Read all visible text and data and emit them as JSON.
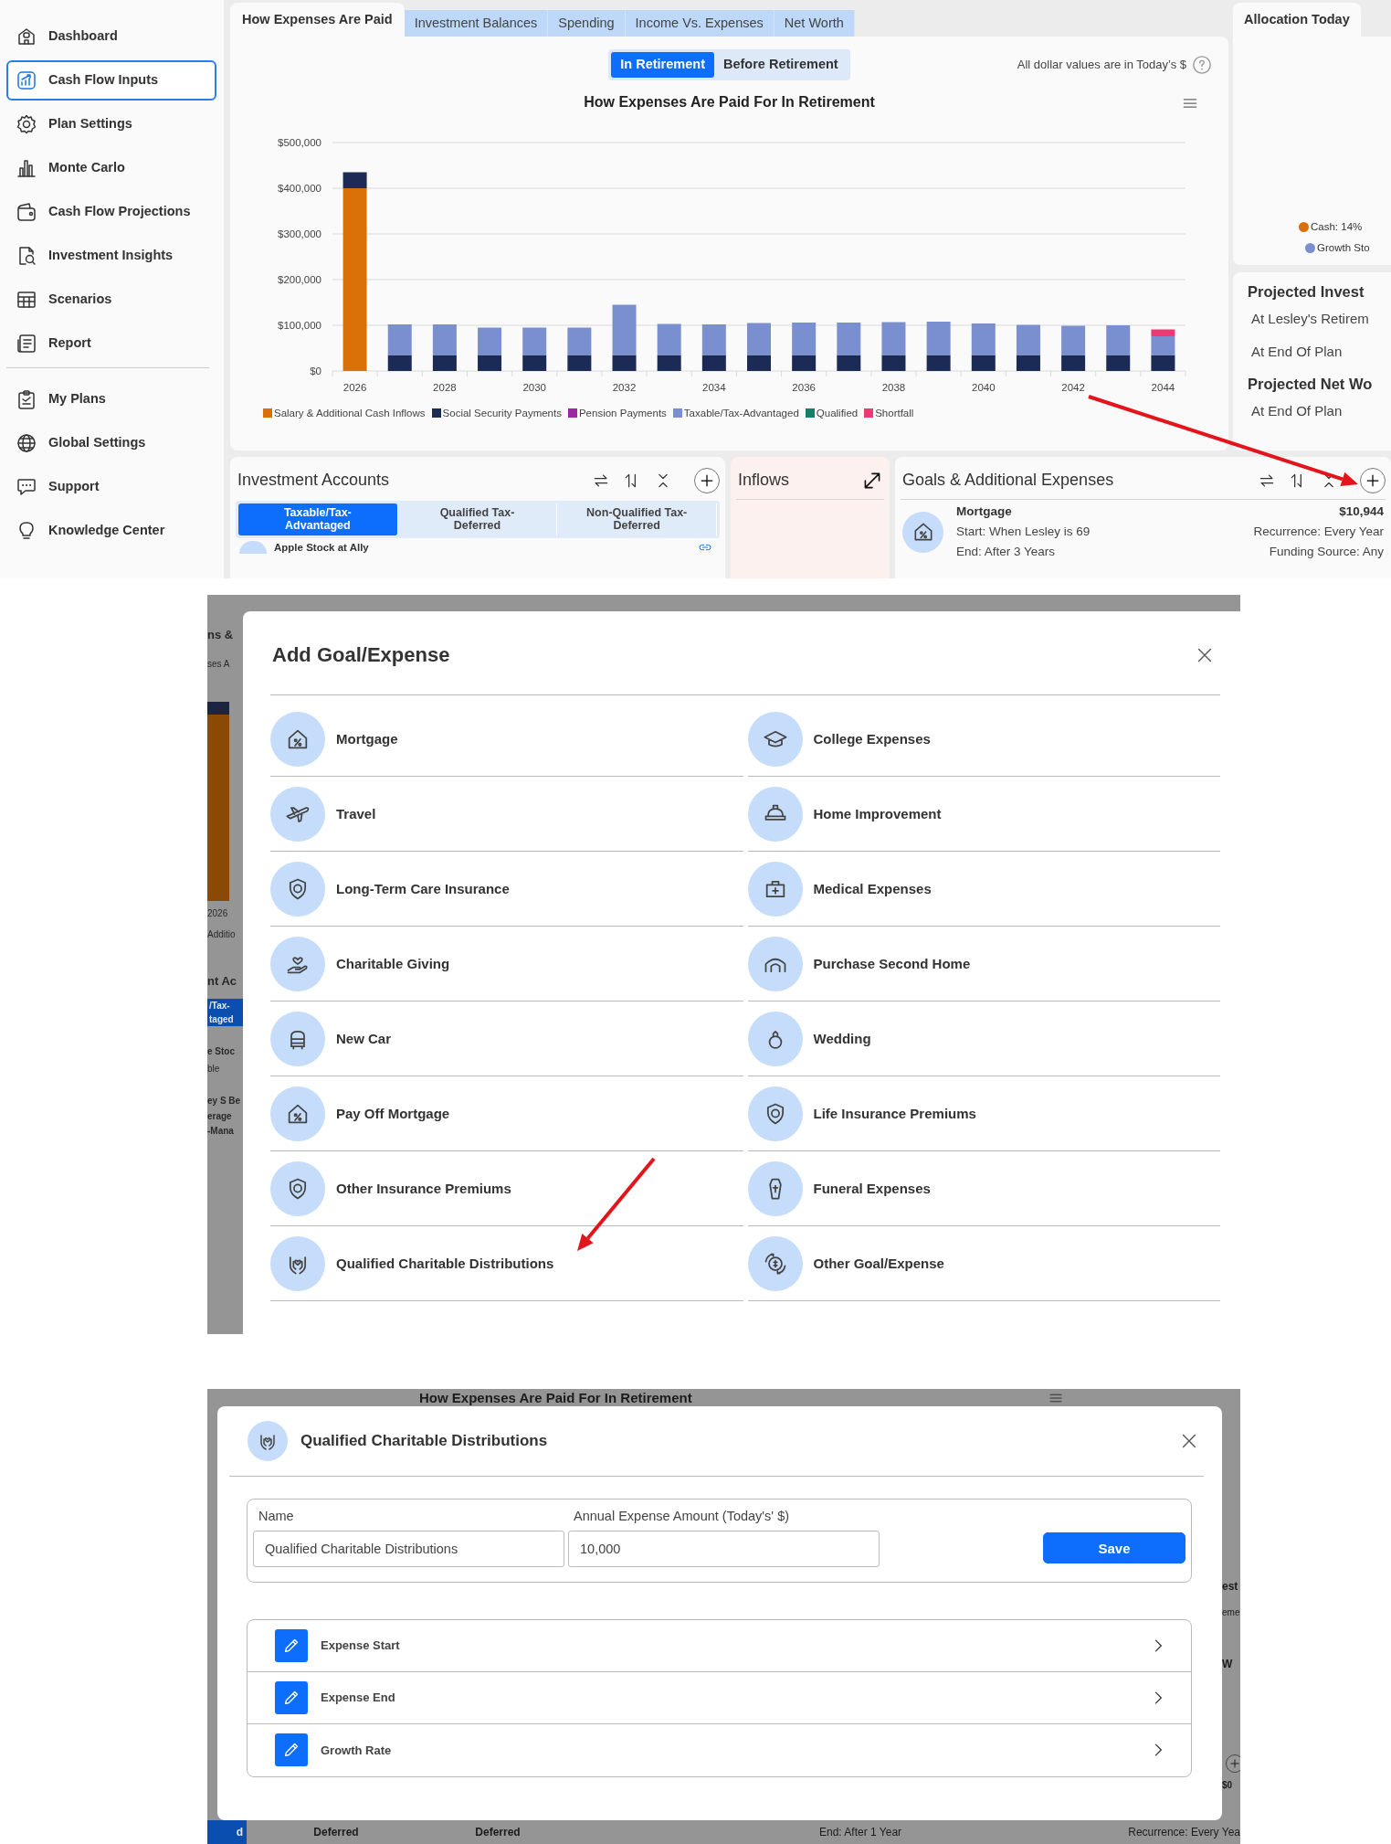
{
  "sidebar": {
    "items": [
      {
        "label": "Dashboard",
        "selected": false
      },
      {
        "label": "Cash Flow Inputs",
        "selected": true
      },
      {
        "label": "Plan Settings",
        "selected": false
      },
      {
        "label": "Monte Carlo",
        "selected": false
      },
      {
        "label": "Cash Flow Projections",
        "selected": false
      },
      {
        "label": "Investment Insights",
        "selected": false
      },
      {
        "label": "Scenarios",
        "selected": false
      },
      {
        "label": "Report",
        "selected": false
      }
    ],
    "secondary_items": [
      {
        "label": "My Plans",
        "selected": false
      },
      {
        "label": "Global Settings",
        "selected": false
      },
      {
        "label": "Support",
        "selected": false
      },
      {
        "label": "Knowledge Center",
        "selected": false
      }
    ]
  },
  "tabs": [
    {
      "label": "How Expenses Are Paid",
      "selected": true
    },
    {
      "label": "Investment Balances",
      "selected": false
    },
    {
      "label": "Spending",
      "selected": false
    },
    {
      "label": "Income Vs. Expenses",
      "selected": false
    },
    {
      "label": "Net Worth",
      "selected": false
    }
  ],
  "side_tab": {
    "label": "Allocation Today",
    "selected": true
  },
  "chart_panel": {
    "toggle": [
      {
        "label": "In Retirement",
        "selected": true
      },
      {
        "label": "Before Retirement",
        "selected": false
      }
    ],
    "note": "All dollar values are in Today’s $",
    "chart_data": {
      "type": "bar",
      "title": "How Expenses Are Paid For In Retirement",
      "stacked": true,
      "grid": true,
      "legend": true,
      "xlim": [
        2025.5,
        2044.5
      ],
      "x": [
        2026,
        2027,
        2028,
        2029,
        2030,
        2031,
        2032,
        2033,
        2034,
        2035,
        2036,
        2037,
        2038,
        2039,
        2040,
        2041,
        2042,
        2043,
        2044
      ],
      "xticks": [
        2026,
        2028,
        2030,
        2032,
        2034,
        2036,
        2038,
        2040,
        2042,
        2044
      ],
      "ylim": [
        0,
        500000
      ],
      "yticks": [
        {
          "value": 0,
          "label": "$0"
        },
        {
          "value": 100000,
          "label": "$100,000"
        },
        {
          "value": 200000,
          "label": "$200,000"
        },
        {
          "value": 300000,
          "label": "$300,000"
        },
        {
          "value": 400000,
          "label": "$400,000"
        },
        {
          "value": 500000,
          "label": "$500,000"
        }
      ],
      "series": [
        {
          "name": "Salary & Additional Cash Inflows",
          "color": "#d97108",
          "values": [
            400000,
            0,
            0,
            0,
            0,
            0,
            0,
            0,
            0,
            0,
            0,
            0,
            0,
            0,
            0,
            0,
            0,
            0,
            0
          ]
        },
        {
          "name": "Social Security Payments",
          "color": "#1c2a56",
          "values": [
            35000,
            35000,
            35000,
            35000,
            35000,
            35000,
            35000,
            35000,
            35000,
            35000,
            35000,
            35000,
            35000,
            35000,
            35000,
            35000,
            35000,
            35000,
            35000
          ]
        },
        {
          "name": "Pension Payments",
          "color": "#9c27a0",
          "values": [
            0,
            0,
            0,
            0,
            0,
            0,
            0,
            0,
            0,
            0,
            0,
            0,
            0,
            0,
            0,
            0,
            0,
            0,
            0
          ]
        },
        {
          "name": "Taxable/Tax-Advantaged",
          "color": "#7a8fd0",
          "values": [
            0,
            67000,
            67000,
            60000,
            60000,
            60000,
            110000,
            68000,
            67000,
            70000,
            71000,
            71000,
            72000,
            73000,
            69000,
            66000,
            64000,
            65000,
            41000
          ]
        },
        {
          "name": "Qualified",
          "color": "#177e6c",
          "values": [
            0,
            0,
            0,
            0,
            0,
            0,
            0,
            0,
            0,
            0,
            0,
            0,
            0,
            0,
            0,
            0,
            0,
            0,
            0
          ]
        },
        {
          "name": "Shortfall",
          "color": "#ee3a74",
          "values": [
            0,
            0,
            0,
            0,
            0,
            0,
            0,
            0,
            0,
            0,
            0,
            0,
            0,
            0,
            0,
            0,
            0,
            0,
            15000
          ]
        }
      ]
    }
  },
  "allocation": {
    "legend": [
      {
        "label": "Cash: 14%",
        "color": "#d97108"
      },
      {
        "label": "Growth Sto",
        "color": "#7a8fd0"
      }
    ]
  },
  "projections": [
    {
      "heading": "Projected Invest",
      "rows": [
        "At Lesley's Retirem",
        "At End Of Plan"
      ]
    },
    {
      "heading": "Projected Net Wo",
      "rows": [
        "At End Of Plan"
      ]
    }
  ],
  "investment_accounts": {
    "title": "Investment Accounts",
    "tabs": [
      {
        "label": "Taxable/Tax-Advantaged",
        "selected": true
      },
      {
        "label": "Qualified Tax-Deferred",
        "selected": false
      },
      {
        "label": "Non-Qualified Tax-Deferred",
        "selected": false
      }
    ],
    "accounts": [
      {
        "name": "Apple Stock at Ally"
      }
    ]
  },
  "inflows": {
    "title": "Inflows"
  },
  "goals": {
    "title": "Goals & Additional Expenses",
    "items": [
      {
        "name": "Mortgage",
        "start": "Start: When Lesley is 69",
        "end": "End: After 3 Years",
        "amount": "$10,944",
        "recurrence": "Recurrence: Every Year",
        "funding": "Funding Source: Any"
      }
    ]
  },
  "add_goal_dialog": {
    "backdrop": [
      {
        "kind": "heading",
        "text": "ns &"
      },
      {
        "kind": "text",
        "text": "ses A"
      },
      {
        "kind": "axis",
        "text": "2026"
      },
      {
        "kind": "text",
        "text": "Additio"
      },
      {
        "kind": "heading",
        "text": "nt Ac"
      },
      {
        "kind": "tab",
        "text": "/Tax-"
      },
      {
        "kind": "tab",
        "text": "taged"
      },
      {
        "kind": "strong",
        "text": "e Stoc"
      },
      {
        "kind": "text",
        "text": "ble"
      },
      {
        "kind": "strong",
        "text": "ey S Be"
      },
      {
        "kind": "strong",
        "text": "erage"
      },
      {
        "kind": "strong",
        "text": "-Mana"
      }
    ],
    "title": "Add Goal/Expense",
    "options": [
      {
        "label": "Mortgage"
      },
      {
        "label": "College Expenses"
      },
      {
        "label": "Travel"
      },
      {
        "label": "Home Improvement"
      },
      {
        "label": "Long-Term Care Insurance"
      },
      {
        "label": "Medical Expenses"
      },
      {
        "label": "Charitable Giving"
      },
      {
        "label": "Purchase Second Home"
      },
      {
        "label": "New Car"
      },
      {
        "label": "Wedding"
      },
      {
        "label": "Pay Off Mortgage"
      },
      {
        "label": "Life Insurance Premiums"
      },
      {
        "label": "Other Insurance Premiums"
      },
      {
        "label": "Funeral Expenses"
      },
      {
        "label": "Qualified Charitable Distributions"
      },
      {
        "label": "Other Goal/Expense"
      }
    ]
  },
  "expense_dialog": {
    "backdrop_top": "How Expenses Are Paid For In Retirement",
    "backdrop_right": [
      {
        "kind": "heading",
        "text": "est"
      },
      {
        "kind": "text",
        "text": "eme"
      },
      {
        "kind": "heading",
        "text": "W"
      },
      {
        "kind": "add"
      },
      {
        "kind": "strong",
        "text": "$0"
      }
    ],
    "backdrop_bottom": [
      {
        "kind": "tab",
        "text": "d"
      },
      {
        "kind": "strong",
        "text": "Deferred"
      },
      {
        "kind": "strong",
        "text": "Deferred"
      },
      {
        "kind": "text",
        "text": "End: After 1 Year"
      },
      {
        "kind": "text",
        "text": "Recurrence: Every Yea"
      }
    ],
    "title": "Qualified Charitable Distributions",
    "fields": [
      {
        "label": "Name",
        "value": "Qualified Charitable Distributions"
      },
      {
        "label": "Annual Expense Amount (Today's' $)",
        "value": "10,000"
      }
    ],
    "save_button": "Save",
    "sections": [
      "Expense Start",
      "Expense End",
      "Growth Rate"
    ]
  }
}
